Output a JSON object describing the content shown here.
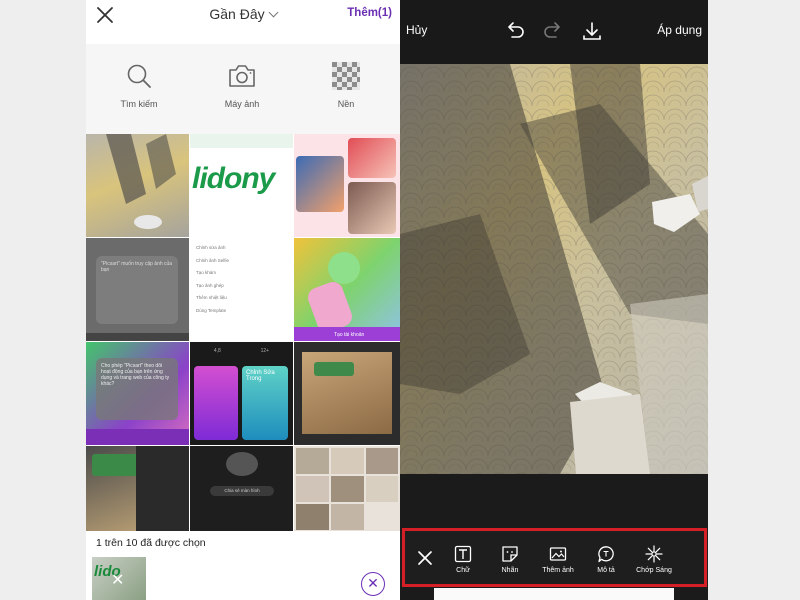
{
  "left": {
    "header": {
      "title": "Gần Đây",
      "more_label": "Thêm(1)"
    },
    "tools": [
      {
        "icon": "search-icon",
        "label": "Tìm kiếm"
      },
      {
        "icon": "camera-icon",
        "label": "Máy ảnh"
      },
      {
        "icon": "transparent-background-icon",
        "label": "Nền"
      }
    ],
    "grid": {
      "tile_texts": {
        "brand": "lidony",
        "popup": "\"Picsart\" muốn truy cập ảnh của bạn",
        "popup2": "Cho phép \"Picsart\" theo dõi hoạt động của bạn trên ứng dụng và trang web của công ty khác?",
        "menu_items": [
          "Chỉnh sửa ảnh",
          "Chỉnh ảnh Selfie",
          "Tạo khám",
          "Tạo ảnh ghép",
          "Thêm nhiệt liệu",
          "Dùng Template"
        ],
        "stats": [
          "4,8",
          "12+",
          "Chỉnh Sửa",
          "Trong"
        ],
        "promo": "Chỉnh Sửa Trong",
        "device_text": "Chia sẻ màn hình",
        "cta": "Tạo tài khoản"
      }
    },
    "selection_text": "1 trên 10 đã được chọn",
    "thumbnail_text": "lido"
  },
  "right": {
    "top_bar": {
      "cancel_label": "Hủy",
      "apply_label": "Áp dụng"
    },
    "bottom_tools": [
      {
        "icon": "text-icon",
        "label": "Chữ"
      },
      {
        "icon": "sticker-icon",
        "label": "Nhãn"
      },
      {
        "icon": "add-photo-icon",
        "label": "Thêm ảnh"
      },
      {
        "icon": "callout-icon",
        "label": "Mô tả"
      },
      {
        "icon": "sparkle-icon",
        "label": "Chớp Sáng"
      }
    ]
  },
  "colors": {
    "accent": "#6a2fb3",
    "highlight": "#d51f26",
    "editor_bg": "#1b1b1b"
  }
}
